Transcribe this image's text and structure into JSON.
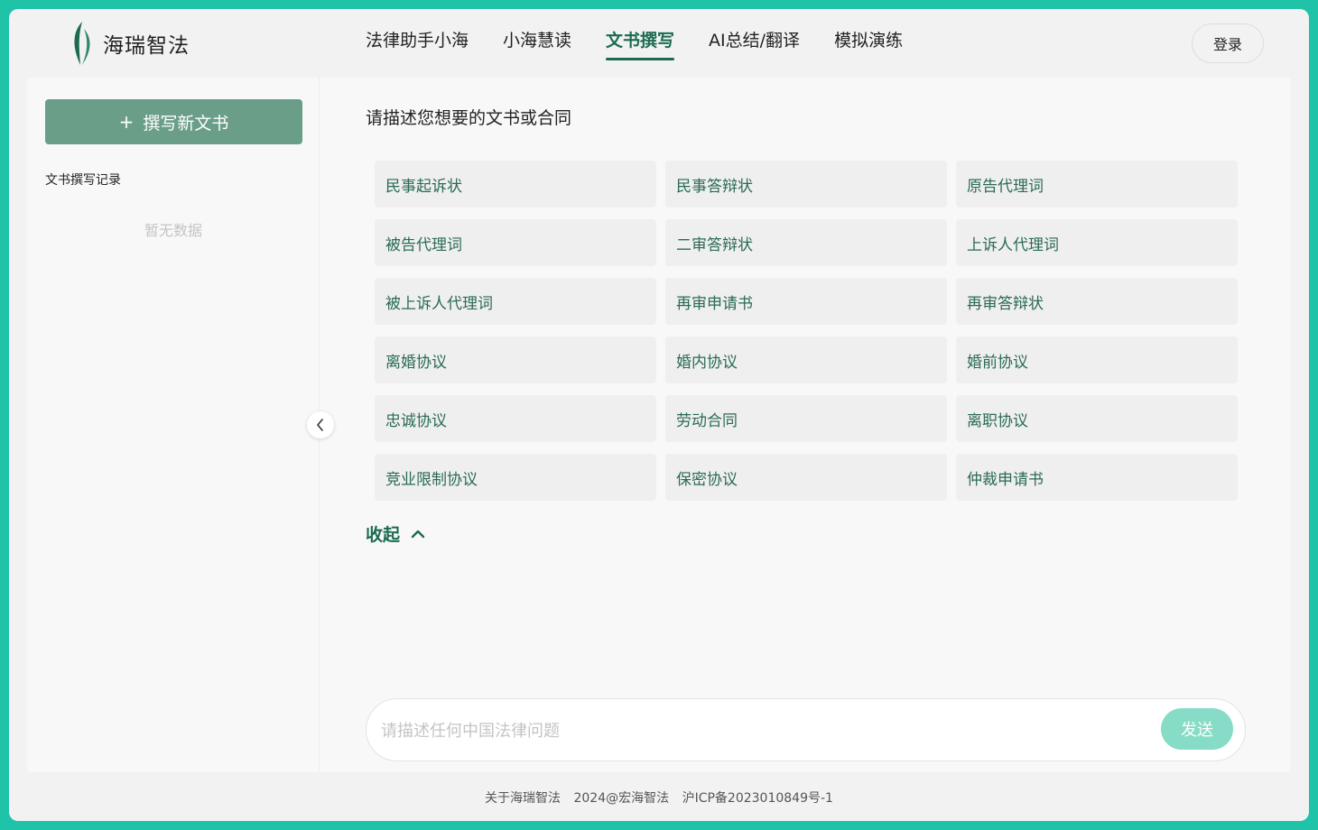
{
  "app": {
    "name": "海瑞智法"
  },
  "nav": {
    "items": [
      {
        "label": "法律助手小海",
        "active": false
      },
      {
        "label": "小海慧读",
        "active": false
      },
      {
        "label": "文书撰写",
        "active": true
      },
      {
        "label": "AI总结/翻译",
        "active": false
      },
      {
        "label": "模拟演练",
        "active": false
      }
    ],
    "login": "登录"
  },
  "sidebar": {
    "new_doc": {
      "icon": "+",
      "label": "撰写新文书"
    },
    "history_title": "文书撰写记录",
    "empty_text": "暂无数据",
    "toggle_icon": "chevron-left-icon"
  },
  "main": {
    "prompt_title": "请描述您想要的文书或合同",
    "templates": [
      "民事起诉状",
      "民事答辩状",
      "原告代理词",
      "被告代理词",
      "二审答辩状",
      "上诉人代理词",
      "被上诉人代理词",
      "再审申请书",
      "再审答辩状",
      "离婚协议",
      "婚内协议",
      "婚前协议",
      "忠诚协议",
      "劳动合同",
      "离职协议",
      "竞业限制协议",
      "保密协议",
      "仲裁申请书"
    ],
    "fold_label": "收起"
  },
  "chat": {
    "placeholder": "请描述任何中国法律问题",
    "send": "发送"
  },
  "footer": {
    "about": "关于海瑞智法",
    "copyright": "2024@宏海智法",
    "icp": "沪ICP备2023010849号-1"
  },
  "colors": {
    "brand_green": "#1b6b4f",
    "button_green": "#6a9e88",
    "send_mint": "#86dcc6",
    "background_teal": "#1ec3a8"
  }
}
